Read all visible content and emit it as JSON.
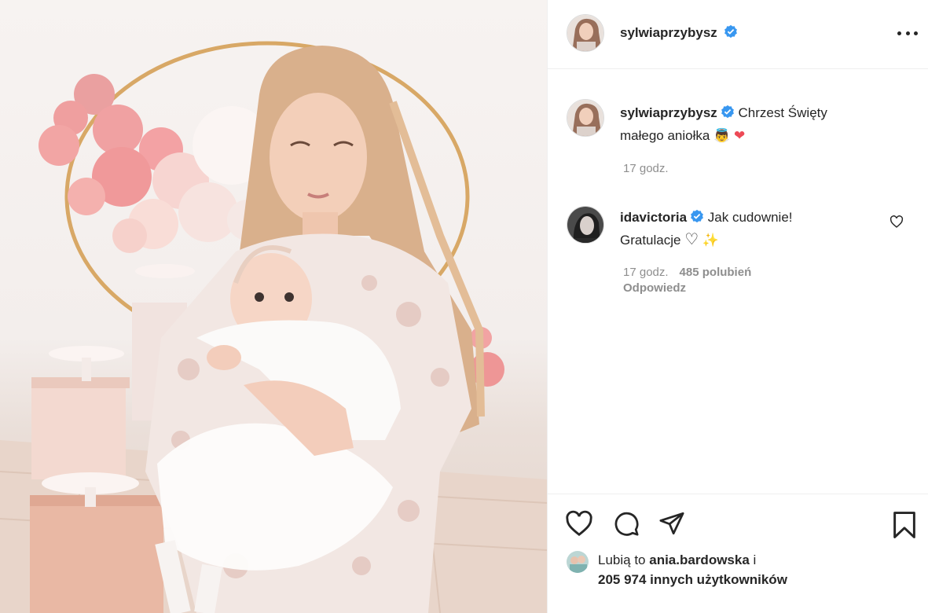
{
  "post": {
    "author": "sylwiaprzybysz",
    "more_icon": "more-horizontal-icon"
  },
  "caption": {
    "author": "sylwiaprzybysz",
    "text": "Chrzest Święty małego aniołka 👼 ❤️",
    "text_line1": "Chrzest Święty",
    "text_line2": "małego aniołka",
    "emoji_angel": "👼",
    "emoji_heart": "❤",
    "time": "17 godz."
  },
  "comments": [
    {
      "author": "idavictoria",
      "text_line1": "Jak cudownie!",
      "text_line2": "Gratulacje",
      "emoji_heart": "♡",
      "emoji_sparkles": "✨",
      "time": "17 godz.",
      "likes": "485 polubień",
      "reply": "Odpowiedz"
    }
  ],
  "actions": {
    "like_icon": "heart-icon",
    "comment_icon": "comment-icon",
    "share_icon": "paper-plane-icon",
    "save_icon": "bookmark-icon"
  },
  "likes": {
    "prefix": "Lubią to",
    "user": "ania.bardowska",
    "connector": "i",
    "others": "205 974 innych użytkowników"
  },
  "colors": {
    "verified": "#3897f0",
    "text": "#262626",
    "muted": "#8e8e8e",
    "border": "#efefef",
    "heart_red": "#ed4956"
  }
}
